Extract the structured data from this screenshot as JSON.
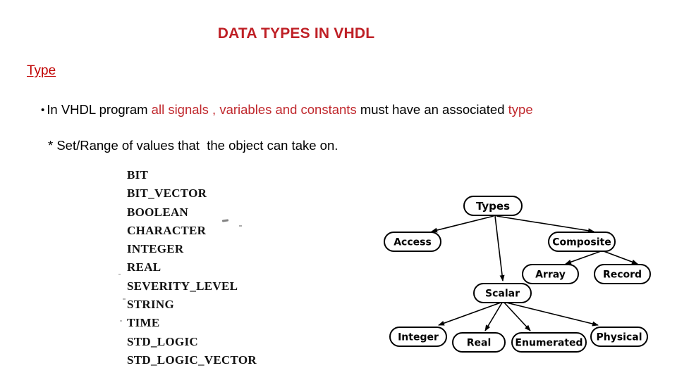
{
  "slide": {
    "title": "DATA TYPES IN VHDL",
    "section_heading": "Type",
    "bullet": {
      "marker": "•",
      "part1_black": "In VHDL program ",
      "part2_red": "all signals , variables and constants",
      "part3_black": " must have an associated ",
      "part4_red": "type"
    },
    "note_line": "* Set/Range of values that  the object can take on.",
    "type_list": [
      "BIT",
      "BIT_VECTOR",
      "BOOLEAN",
      "CHARACTER",
      "INTEGER",
      "REAL",
      "SEVERITY_LEVEL",
      "STRING",
      "TIME",
      "STD_LOGIC",
      "STD_LOGIC_VECTOR"
    ],
    "colors": {
      "title_red": "#bf2026",
      "heading_red": "#c00000",
      "accent_red": "#c0282d",
      "text_black": "#000000",
      "diagram_stroke": "#000000",
      "background": "#ffffff"
    }
  },
  "diagram": {
    "type": "tree",
    "root": "Types",
    "nodes": [
      {
        "id": "types",
        "label": "Types"
      },
      {
        "id": "access",
        "label": "Access"
      },
      {
        "id": "composite",
        "label": "Composite"
      },
      {
        "id": "array",
        "label": "Array"
      },
      {
        "id": "record",
        "label": "Record"
      },
      {
        "id": "scalar",
        "label": "Scalar"
      },
      {
        "id": "integer",
        "label": "Integer"
      },
      {
        "id": "real",
        "label": "Real"
      },
      {
        "id": "enumerated",
        "label": "Enumerated"
      },
      {
        "id": "physical",
        "label": "Physical"
      }
    ],
    "edges": [
      {
        "from": "Types",
        "to": "Access"
      },
      {
        "from": "Types",
        "to": "Scalar"
      },
      {
        "from": "Types",
        "to": "Composite"
      },
      {
        "from": "Composite",
        "to": "Array"
      },
      {
        "from": "Composite",
        "to": "Record"
      },
      {
        "from": "Scalar",
        "to": "Integer"
      },
      {
        "from": "Scalar",
        "to": "Real"
      },
      {
        "from": "Scalar",
        "to": "Enumerated"
      },
      {
        "from": "Scalar",
        "to": "Physical"
      }
    ]
  }
}
